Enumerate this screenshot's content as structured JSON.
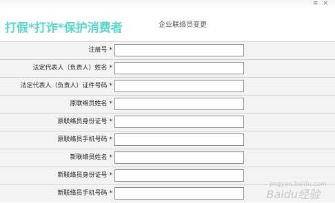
{
  "page": {
    "watermark": "打假*打诈*保护消费者",
    "title": "企业联络员变更",
    "corner": "≡ ×"
  },
  "form": {
    "required_mark": "*",
    "rows": [
      {
        "label": "注册号",
        "value": ""
      },
      {
        "label": "法定代表人（负责人）姓名",
        "value": ""
      },
      {
        "label": "法定代表人（负责人）证件号码",
        "value": ""
      },
      {
        "label": "原联络员姓名",
        "value": ""
      },
      {
        "label": "原联络员身份证号",
        "value": ""
      },
      {
        "label": "原联络员手机号码",
        "value": ""
      },
      {
        "label": "新联络员姓名",
        "value": ""
      },
      {
        "label": "新联络员身份证号",
        "value": ""
      },
      {
        "label": "新联络员手机号码",
        "value": ""
      }
    ]
  },
  "baidu_watermark": {
    "text": "Baidu经验",
    "sub": "jingyan.baidu.com"
  }
}
